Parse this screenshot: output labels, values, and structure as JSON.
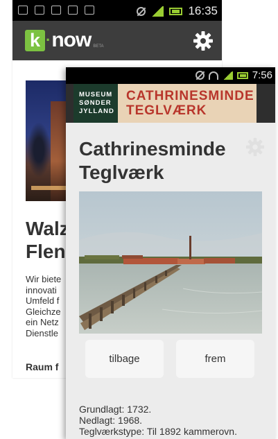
{
  "back": {
    "status_time": "16:35",
    "logo": {
      "k": "k",
      "dot": "·",
      "word": "now",
      "beta": "BETA"
    },
    "title_lines": [
      "Walz",
      "Flen"
    ],
    "body_lines": [
      "Wir biete",
      "innovati",
      "Umfeld f",
      "Gleichze",
      "ein Netz",
      "Dienstle"
    ],
    "subheading": "Raum f"
  },
  "front": {
    "status_time": "7:56",
    "museum_lines": [
      "MUSEUM",
      "SØNDER",
      "JYLLAND"
    ],
    "banner_lines": [
      "CATHRINESMINDE",
      "TEGLVÆRK"
    ],
    "title_lines": [
      "Cathrinesminde",
      "Teglværk"
    ],
    "buttons": {
      "back_label": "tilbage",
      "next_label": "frem"
    },
    "facts": [
      "Grundlagt: 1732.",
      "Nedlagt: 1968.",
      "Teglværkstype: Til 1892 kammerovn."
    ]
  },
  "colors": {
    "appbar": "#3d3d3d",
    "logo_green": "#7cc241",
    "museum_green": "#1c3b2c",
    "banner_bg": "#e9d3b6",
    "banner_text": "#b8352b"
  },
  "icons": [
    "settings-gear-icon",
    "signal-icon",
    "battery-icon",
    "wifi-icon",
    "mute-icon"
  ]
}
